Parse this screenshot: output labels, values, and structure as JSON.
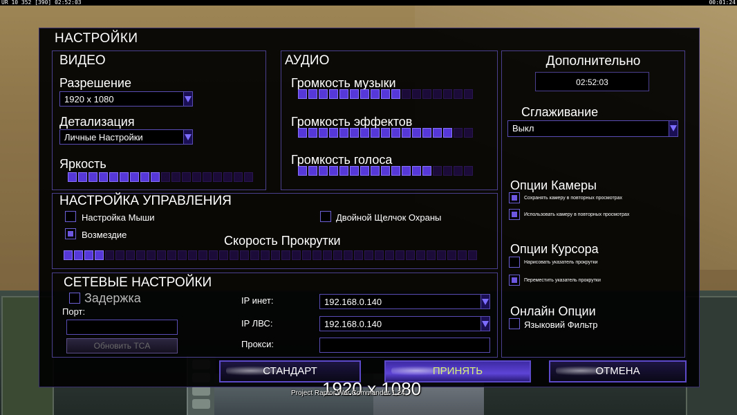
{
  "status_bar": {
    "left": "UR 10 352 [390] 02:52:03",
    "right": "00:01:24"
  },
  "dialog": {
    "title": "НАСТРОЙКИ"
  },
  "video": {
    "title": "ВИДЕО",
    "resolution_label": "Разрешение",
    "resolution_value": "1920 x 1080",
    "detail_label": "Детализация",
    "detail_value": "Личные Настройки",
    "brightness_label": "Яркость",
    "brightness_level": 0.5
  },
  "audio": {
    "title": "АУДИО",
    "music_label": "Громкость музыки",
    "music_level": 0.59,
    "effects_label": "Громкость эффектов",
    "effects_level": 0.87,
    "voice_label": "Громкость голоса",
    "voice_level": 0.74
  },
  "extra": {
    "title": "Дополнительно",
    "clock": "02:52:03",
    "antialias_label": "Сглаживание",
    "antialias_value": "Выкл",
    "camera_title": "Опции Камеры",
    "camera_opt1": "Сохранять камеру в повторных просмотрах",
    "camera_opt1_checked": true,
    "camera_opt2": "Использовать камеру в повторных просмотрах",
    "camera_opt2_checked": true,
    "cursor_title": "Опции Курсора",
    "cursor_opt1": "Нарисовать указатель прокрутки",
    "cursor_opt1_checked": false,
    "cursor_opt2": "Переместить указатель прокрутки",
    "cursor_opt2_checked": true,
    "online_title": "Онлайн Опции",
    "online_opt1": "Языковий Фильтр",
    "online_opt1_checked": false
  },
  "controls": {
    "title": "НАСТРОЙКА УПРАВЛЕНИЯ",
    "mouse_label": "Настройка Мыши",
    "mouse_checked": false,
    "retaliation_label": "Возмездие",
    "retaliation_checked": true,
    "guard_label": "Двойной Щелчок Охраны",
    "guard_checked": false,
    "scroll_label": "Скорость Прокрутки",
    "scroll_level": 0.1
  },
  "network": {
    "title": "СЕТЕВЫЕ НАСТРОЙКИ",
    "delay_label": "Задержка",
    "delay_checked": false,
    "port_label": "Порт:",
    "port_value": "",
    "update_button": "Обновить TCA",
    "ip_inet_label": "IP инет:",
    "ip_inet_value": "192.168.0.140",
    "ip_lan_label": "IP ЛВС:",
    "ip_lan_value": "192.168.0.140",
    "proxy_label": "Прокси:",
    "proxy_value": ""
  },
  "buttons": {
    "default": "СТАНДАРТ",
    "accept": "ПРИНЯТЬ",
    "cancel": "ОТМЕНА"
  },
  "footer": {
    "resolution": "1920 x 1080",
    "version": "Project Raptor War Commander 1.24"
  },
  "colors": {
    "accent": "#5637d8",
    "panel_border": "#4b3f8f",
    "accept_text": "#d8f27a"
  }
}
